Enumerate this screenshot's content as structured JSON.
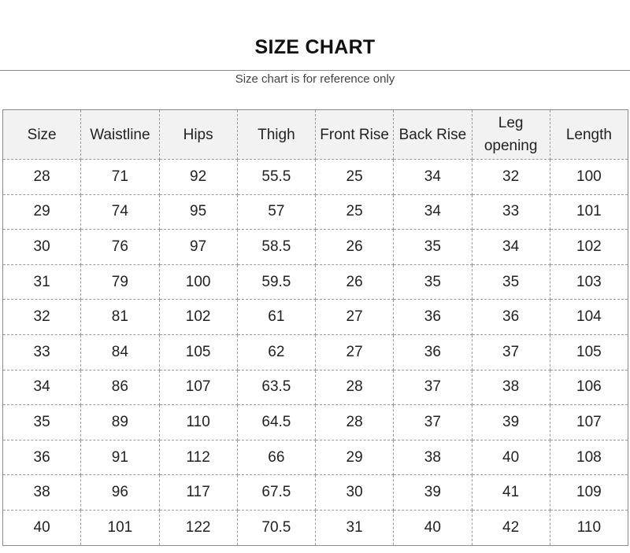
{
  "title": "SIZE CHART",
  "subtitle": "Size chart is for reference only",
  "table": {
    "headers": [
      "Size",
      "Waistline",
      "Hips",
      "Thigh",
      "Front Rise",
      "Back Rise",
      "Leg opening",
      "Length"
    ],
    "rows": [
      [
        "28",
        "71",
        "92",
        "55.5",
        "25",
        "34",
        "32",
        "100"
      ],
      [
        "29",
        "74",
        "95",
        "57",
        "25",
        "34",
        "33",
        "101"
      ],
      [
        "30",
        "76",
        "97",
        "58.5",
        "26",
        "35",
        "34",
        "102"
      ],
      [
        "31",
        "79",
        "100",
        "59.5",
        "26",
        "35",
        "35",
        "103"
      ],
      [
        "32",
        "81",
        "102",
        "61",
        "27",
        "36",
        "36",
        "104"
      ],
      [
        "33",
        "84",
        "105",
        "62",
        "27",
        "36",
        "37",
        "105"
      ],
      [
        "34",
        "86",
        "107",
        "63.5",
        "28",
        "37",
        "38",
        "106"
      ],
      [
        "35",
        "89",
        "110",
        "64.5",
        "28",
        "37",
        "39",
        "107"
      ],
      [
        "36",
        "91",
        "112",
        "66",
        "29",
        "38",
        "40",
        "108"
      ],
      [
        "38",
        "96",
        "117",
        "67.5",
        "30",
        "39",
        "41",
        "109"
      ],
      [
        "40",
        "101",
        "122",
        "70.5",
        "31",
        "40",
        "42",
        "110"
      ]
    ]
  },
  "colors": {
    "header_bg": "#f2f2f2",
    "border": "#9a9a9a",
    "text": "#222222"
  }
}
